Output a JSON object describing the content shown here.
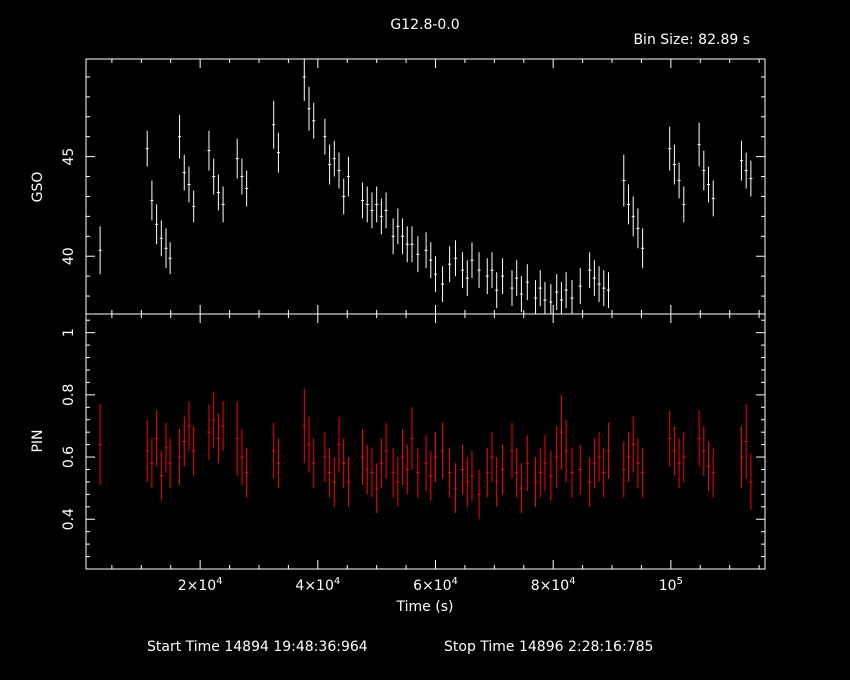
{
  "title": "G12.8-0.0",
  "bin_size_label": "Bin Size: 82.89 s",
  "xlabel": "Time (s)",
  "start_time_label": "Start Time 14894 19:48:36:964",
  "stop_time_label": "Stop Time 14896  2:28:16:785",
  "colors": {
    "gso": "#ffffff",
    "pin": "#ff0000",
    "axes": "#ffffff",
    "background": "#000000"
  },
  "chart_data": {
    "type": "scatter",
    "x_range": [
      600,
      116000
    ],
    "x_ticks": [
      {
        "value": 20000,
        "base": "2×10",
        "exp": "4"
      },
      {
        "value": 40000,
        "base": "4×10",
        "exp": "4"
      },
      {
        "value": 60000,
        "base": "6×10",
        "exp": "4"
      },
      {
        "value": 80000,
        "base": "8×10",
        "exp": "4"
      },
      {
        "value": 100000,
        "base": "10",
        "exp": "5"
      }
    ],
    "panels": [
      {
        "ylabel": "GSO",
        "ylim": [
          37.1,
          49.9
        ],
        "y_ticks": [
          40,
          45
        ],
        "series": {
          "x": [
            3000,
            11000,
            11800,
            12600,
            13400,
            14200,
            14900,
            16500,
            17300,
            18100,
            18900,
            21500,
            22300,
            23100,
            23900,
            26300,
            27100,
            27900,
            32500,
            33300,
            37700,
            38500,
            39300,
            41200,
            42000,
            42800,
            43600,
            44400,
            45200,
            47600,
            48400,
            49200,
            50000,
            50800,
            51600,
            52800,
            53600,
            54400,
            55200,
            56000,
            57000,
            58400,
            59200,
            60000,
            61200,
            62400,
            63400,
            64600,
            65400,
            66200,
            67400,
            68800,
            69600,
            70400,
            71400,
            73000,
            73800,
            74600,
            75600,
            77000,
            77800,
            78600,
            79600,
            80600,
            81400,
            82200,
            83200,
            84600,
            86200,
            87000,
            87800,
            88600,
            89400,
            92000,
            92800,
            93600,
            94400,
            95200,
            99800,
            100600,
            101400,
            102200,
            104800,
            105600,
            106400,
            107200,
            112000,
            112800,
            113600
          ],
          "y": [
            40.3,
            45.4,
            42.8,
            41.6,
            40.9,
            40.4,
            39.9,
            46.0,
            44.2,
            43.6,
            42.5,
            45.3,
            44.0,
            43.2,
            42.6,
            44.9,
            44.0,
            43.4,
            46.6,
            45.2,
            49.0,
            47.4,
            46.8,
            46.0,
            44.6,
            44.9,
            44.3,
            43.0,
            44.0,
            42.8,
            42.6,
            42.3,
            42.6,
            42.0,
            42.3,
            41.0,
            41.5,
            41.0,
            40.6,
            40.6,
            40.1,
            40.3,
            39.8,
            39.1,
            38.6,
            39.6,
            39.9,
            39.3,
            38.9,
            39.8,
            39.3,
            39.0,
            39.3,
            38.3,
            39.0,
            38.4,
            38.9,
            38.1,
            38.7,
            37.9,
            38.4,
            37.8,
            37.7,
            38.2,
            37.8,
            38.3,
            37.9,
            38.5,
            39.3,
            38.9,
            38.6,
            38.4,
            38.3,
            43.8,
            42.6,
            42.0,
            41.4,
            40.4,
            45.4,
            44.6,
            43.8,
            42.6,
            45.6,
            44.3,
            43.6,
            42.9,
            44.8,
            44.3,
            43.9
          ],
          "err": [
            1.2,
            0.9,
            1.0,
            1.0,
            0.9,
            1.0,
            0.8,
            1.1,
            0.9,
            0.9,
            0.8,
            1.0,
            0.9,
            0.9,
            0.9,
            1.0,
            0.9,
            0.9,
            1.2,
            1.0,
            1.2,
            1.1,
            0.9,
            0.9,
            1.0,
            0.9,
            0.9,
            0.9,
            1.0,
            0.9,
            0.9,
            0.9,
            0.9,
            0.9,
            0.9,
            0.9,
            0.9,
            0.9,
            0.9,
            0.9,
            0.9,
            0.9,
            0.9,
            0.9,
            0.9,
            0.9,
            0.9,
            0.9,
            0.9,
            0.9,
            0.9,
            0.9,
            0.9,
            0.9,
            0.9,
            0.9,
            0.9,
            0.9,
            0.9,
            0.9,
            0.9,
            0.9,
            0.9,
            0.9,
            0.9,
            0.9,
            0.9,
            0.9,
            0.9,
            0.9,
            0.9,
            0.9,
            0.9,
            1.3,
            1.0,
            1.0,
            1.0,
            1.0,
            1.1,
            1.0,
            0.9,
            0.9,
            1.1,
            1.0,
            0.9,
            0.9,
            1.0,
            0.9,
            0.9
          ]
        }
      },
      {
        "ylabel": "PIN",
        "ylim": [
          0.24,
          1.06
        ],
        "y_ticks": [
          0.4,
          0.6,
          0.8,
          1
        ],
        "series": {
          "x": [
            3000,
            11000,
            11800,
            12600,
            13400,
            14200,
            14900,
            16500,
            17300,
            18100,
            18900,
            21500,
            22300,
            23100,
            23900,
            26300,
            27100,
            27900,
            32500,
            33300,
            37700,
            38500,
            39300,
            41200,
            42000,
            42800,
            43600,
            44400,
            45200,
            47600,
            48400,
            49200,
            50000,
            50800,
            51600,
            52800,
            53600,
            54400,
            55200,
            56000,
            57000,
            58400,
            59200,
            60000,
            61200,
            62400,
            63400,
            64600,
            65400,
            66200,
            67400,
            68800,
            69600,
            70400,
            71400,
            73000,
            73800,
            74600,
            75600,
            77000,
            77800,
            78600,
            79600,
            80600,
            81400,
            82200,
            83200,
            84600,
            86200,
            87000,
            87800,
            88600,
            89400,
            92000,
            92800,
            93600,
            94400,
            95200,
            99800,
            100600,
            101400,
            102200,
            104800,
            105600,
            106400,
            107200,
            112000,
            112800,
            113600
          ],
          "y": [
            0.64,
            0.62,
            0.58,
            0.66,
            0.54,
            0.63,
            0.58,
            0.6,
            0.65,
            0.7,
            0.62,
            0.68,
            0.72,
            0.66,
            0.7,
            0.66,
            0.6,
            0.55,
            0.62,
            0.58,
            0.7,
            0.64,
            0.58,
            0.6,
            0.55,
            0.52,
            0.64,
            0.58,
            0.52,
            0.6,
            0.56,
            0.55,
            0.5,
            0.58,
            0.62,
            0.55,
            0.52,
            0.6,
            0.56,
            0.66,
            0.55,
            0.58,
            0.54,
            0.6,
            0.62,
            0.55,
            0.5,
            0.56,
            0.52,
            0.54,
            0.48,
            0.55,
            0.6,
            0.52,
            0.56,
            0.62,
            0.55,
            0.5,
            0.58,
            0.52,
            0.55,
            0.58,
            0.54,
            0.6,
            0.68,
            0.62,
            0.55,
            0.56,
            0.52,
            0.58,
            0.6,
            0.55,
            0.62,
            0.56,
            0.6,
            0.64,
            0.58,
            0.55,
            0.66,
            0.62,
            0.58,
            0.6,
            0.66,
            0.62,
            0.57,
            0.55,
            0.6,
            0.65,
            0.52
          ],
          "err": [
            0.13,
            0.1,
            0.08,
            0.09,
            0.08,
            0.08,
            0.08,
            0.09,
            0.08,
            0.08,
            0.08,
            0.09,
            0.09,
            0.08,
            0.08,
            0.12,
            0.09,
            0.08,
            0.09,
            0.08,
            0.12,
            0.09,
            0.08,
            0.08,
            0.08,
            0.08,
            0.09,
            0.08,
            0.08,
            0.09,
            0.08,
            0.08,
            0.08,
            0.08,
            0.09,
            0.08,
            0.08,
            0.09,
            0.08,
            0.1,
            0.08,
            0.09,
            0.08,
            0.08,
            0.09,
            0.08,
            0.08,
            0.08,
            0.08,
            0.08,
            0.08,
            0.08,
            0.08,
            0.08,
            0.08,
            0.09,
            0.08,
            0.08,
            0.09,
            0.08,
            0.08,
            0.09,
            0.08,
            0.1,
            0.12,
            0.1,
            0.08,
            0.08,
            0.08,
            0.08,
            0.08,
            0.08,
            0.09,
            0.09,
            0.08,
            0.09,
            0.08,
            0.08,
            0.09,
            0.08,
            0.08,
            0.08,
            0.09,
            0.08,
            0.08,
            0.08,
            0.1,
            0.12,
            0.09
          ]
        }
      }
    ]
  }
}
